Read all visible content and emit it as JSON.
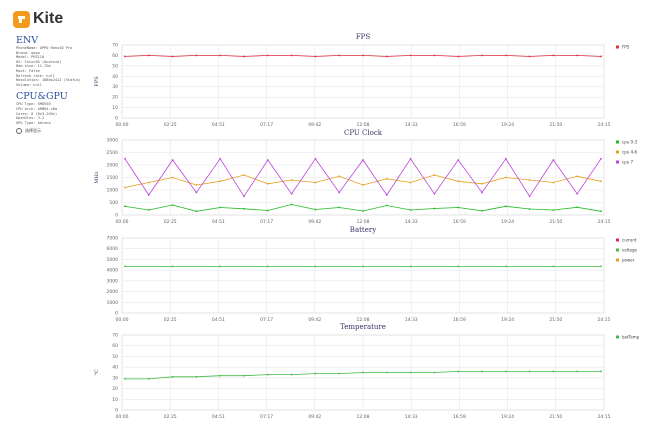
{
  "logo": {
    "text": "Kite",
    "icon": "kite-logo-icon",
    "color": "#f39a1c"
  },
  "sidebar": {
    "env_title": "ENV",
    "env_lines": [
      "PhoneName: OPPO Reno10 Pro",
      "Brand: oppo",
      "Model: PHZ110",
      "OS: ColorOS (Android)",
      "Ram size: 11.7Gb",
      "Root: False",
      "Refresh rate: null",
      "Resolution: 1080x2412 (Status)",
      "Volume: null"
    ],
    "gpu_title": "CPU&GPU",
    "gpu_lines": [
      "CPU Type: SM8550",
      "CPU Arch: ARM64-v8a",
      "Cores: 8 (8x3.2GHz)",
      "OpenGles: 3.2",
      "GPU Type: Adreno"
    ],
    "radio_label": "选择显示",
    "radio_icon": "radio-button-icon"
  },
  "x_ticks": [
    "00:00",
    "02:25",
    "04:51",
    "07:17",
    "09:42",
    "12:08",
    "14:33",
    "16:59",
    "19:24",
    "21:50",
    "24:15"
  ],
  "chart_data": [
    {
      "type": "line",
      "title": "FPS",
      "ylabel": "FPS",
      "ylim": [
        0,
        70
      ],
      "yticks": [
        "0",
        "10",
        "20",
        "30",
        "40",
        "50",
        "60",
        "70"
      ],
      "grid": true,
      "legend_position": "right",
      "series": [
        {
          "name": "FPS",
          "color": "#e03040",
          "values": [
            59,
            60,
            59,
            60,
            60,
            59,
            60,
            60,
            59,
            60,
            60,
            59,
            60,
            60,
            59,
            60,
            60,
            59,
            60,
            60,
            59
          ]
        }
      ]
    },
    {
      "type": "line",
      "title": "CPU Clock",
      "ylabel": "MHz",
      "ylim": [
        0,
        3000
      ],
      "yticks": [
        "0",
        "500",
        "1000",
        "1500",
        "2000",
        "2500",
        "3000"
      ],
      "grid": true,
      "legend_position": "right",
      "series": [
        {
          "name": "cpu 0-3",
          "color": "#22bb22",
          "values": [
            350,
            200,
            400,
            150,
            300,
            250,
            180,
            420,
            220,
            300,
            160,
            380,
            200,
            260,
            300,
            170,
            350,
            240,
            200,
            310,
            150
          ]
        },
        {
          "name": "cpu 4-6",
          "color": "#e6a020",
          "values": [
            1100,
            1300,
            1500,
            1200,
            1350,
            1600,
            1250,
            1400,
            1300,
            1550,
            1200,
            1450,
            1300,
            1600,
            1350,
            1250,
            1500,
            1400,
            1300,
            1550,
            1350
          ]
        },
        {
          "name": "cpu 7",
          "color": "#bb44dd",
          "values": [
            2250,
            800,
            2200,
            900,
            2250,
            750,
            2200,
            850,
            2250,
            900,
            2200,
            800,
            2250,
            850,
            2200,
            900,
            2250,
            750,
            2200,
            850,
            2250
          ]
        }
      ]
    },
    {
      "type": "line",
      "title": "Battery",
      "ylabel": "",
      "ylim": [
        0,
        7000
      ],
      "yticks": [
        "0",
        "1000",
        "2000",
        "3000",
        "4000",
        "5000",
        "6000",
        "7000"
      ],
      "grid": true,
      "legend_position": "right",
      "series": [
        {
          "name": "current",
          "color": "#dd2288",
          "values": []
        },
        {
          "name": "voltage",
          "color": "#44bb44",
          "values": [
            4350,
            4350,
            4350,
            4350,
            4350,
            4350,
            4350,
            4350,
            4350,
            4350,
            4350
          ]
        },
        {
          "name": "power",
          "color": "#e6a020",
          "values": []
        }
      ]
    },
    {
      "type": "line",
      "title": "Temperature",
      "ylabel": "°C",
      "ylim": [
        0,
        70
      ],
      "yticks": [
        "0",
        "10",
        "20",
        "30",
        "40",
        "50",
        "60",
        "70"
      ],
      "grid": true,
      "legend_position": "right",
      "series": [
        {
          "name": "batTemp",
          "color": "#44bb44",
          "values": [
            29,
            29,
            31,
            31,
            32,
            32,
            33,
            33,
            34,
            34,
            35,
            35,
            35,
            35,
            36,
            36,
            36,
            36,
            36,
            36,
            36
          ]
        }
      ]
    }
  ]
}
